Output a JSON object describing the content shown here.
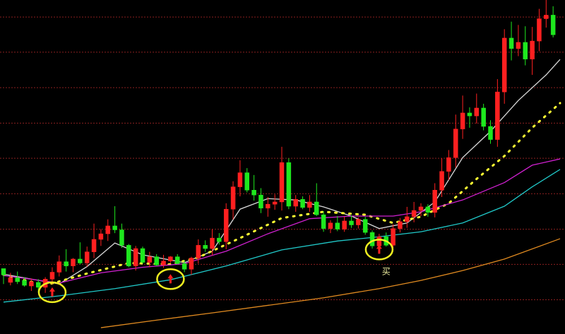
{
  "colors": {
    "background": "#000000",
    "grid": "#8a1f1f",
    "up_candle": "#ff2020",
    "down_candle": "#1ee81e",
    "ma_short": "#d8d8d8",
    "ma_dotted": "#ffff33",
    "ma_mid": "#d020d0",
    "ma_cyan": "#20c8c8",
    "ma_long": "#e08a20",
    "highlight_circle": "#f0f020",
    "signal_arrow": "#ff2020",
    "label": "#f0f0a0"
  },
  "annotations": {
    "buy_label": "买"
  },
  "chart_data": {
    "type": "candlestick",
    "title": "",
    "xlabel": "",
    "ylabel": "",
    "ylim": [
      0,
      100
    ],
    "grid": true,
    "gridlines_y": [
      8.7,
      19.5,
      30.2,
      41.0,
      51.8,
      62.5,
      73.3,
      84.1,
      94.8
    ],
    "candles": [
      {
        "o": 16.3,
        "h": 17.8,
        "l": 13.5,
        "c": 18.2,
        "dir": "down"
      },
      {
        "o": 14.0,
        "h": 16.9,
        "l": 13.1,
        "c": 15.4,
        "dir": "up"
      },
      {
        "o": 15.4,
        "h": 17.3,
        "l": 13.5,
        "c": 14.2,
        "dir": "down"
      },
      {
        "o": 14.6,
        "h": 15.6,
        "l": 12.7,
        "c": 13.1,
        "dir": "down"
      },
      {
        "o": 12.9,
        "h": 15.2,
        "l": 11.4,
        "c": 14.2,
        "dir": "up"
      },
      {
        "o": 14.0,
        "h": 15.0,
        "l": 11.0,
        "c": 12.5,
        "dir": "down"
      },
      {
        "o": 12.5,
        "h": 15.6,
        "l": 10.8,
        "c": 15.0,
        "dir": "up"
      },
      {
        "o": 15.0,
        "h": 18.6,
        "l": 13.5,
        "c": 17.1,
        "dir": "up"
      },
      {
        "o": 17.1,
        "h": 22.2,
        "l": 15.8,
        "c": 20.3,
        "dir": "up"
      },
      {
        "o": 20.3,
        "h": 24.1,
        "l": 17.3,
        "c": 19.0,
        "dir": "down"
      },
      {
        "o": 19.0,
        "h": 21.4,
        "l": 17.1,
        "c": 21.1,
        "dir": "up"
      },
      {
        "o": 21.1,
        "h": 26.2,
        "l": 19.5,
        "c": 19.9,
        "dir": "down"
      },
      {
        "o": 19.9,
        "h": 24.9,
        "l": 18.8,
        "c": 23.3,
        "dir": "up"
      },
      {
        "o": 23.3,
        "h": 31.9,
        "l": 21.4,
        "c": 27.1,
        "dir": "up"
      },
      {
        "o": 27.1,
        "h": 30.2,
        "l": 25.1,
        "c": 28.8,
        "dir": "up"
      },
      {
        "o": 28.8,
        "h": 33.2,
        "l": 26.6,
        "c": 31.2,
        "dir": "up"
      },
      {
        "o": 31.2,
        "h": 37.2,
        "l": 29.0,
        "c": 30.0,
        "dir": "down"
      },
      {
        "o": 30.0,
        "h": 31.9,
        "l": 24.5,
        "c": 25.3,
        "dir": "down"
      },
      {
        "o": 25.3,
        "h": 25.7,
        "l": 18.6,
        "c": 19.0,
        "dir": "down"
      },
      {
        "o": 19.0,
        "h": 25.1,
        "l": 17.6,
        "c": 24.3,
        "dir": "up"
      },
      {
        "o": 24.3,
        "h": 24.9,
        "l": 19.7,
        "c": 20.1,
        "dir": "down"
      },
      {
        "o": 20.1,
        "h": 23.3,
        "l": 18.6,
        "c": 21.8,
        "dir": "up"
      },
      {
        "o": 21.8,
        "h": 22.6,
        "l": 19.0,
        "c": 19.3,
        "dir": "down"
      },
      {
        "o": 19.3,
        "h": 22.4,
        "l": 18.4,
        "c": 20.5,
        "dir": "up"
      },
      {
        "o": 20.5,
        "h": 22.0,
        "l": 19.9,
        "c": 21.8,
        "dir": "up"
      },
      {
        "o": 21.8,
        "h": 22.6,
        "l": 19.5,
        "c": 19.7,
        "dir": "down"
      },
      {
        "o": 19.7,
        "h": 20.7,
        "l": 17.1,
        "c": 18.0,
        "dir": "down"
      },
      {
        "o": 18.0,
        "h": 21.8,
        "l": 16.3,
        "c": 21.4,
        "dir": "up"
      },
      {
        "o": 21.4,
        "h": 27.1,
        "l": 19.7,
        "c": 25.3,
        "dir": "up"
      },
      {
        "o": 25.3,
        "h": 26.8,
        "l": 23.3,
        "c": 24.3,
        "dir": "down"
      },
      {
        "o": 24.3,
        "h": 30.2,
        "l": 22.2,
        "c": 27.5,
        "dir": "up"
      },
      {
        "o": 27.5,
        "h": 29.0,
        "l": 25.5,
        "c": 26.4,
        "dir": "down"
      },
      {
        "o": 26.4,
        "h": 38.1,
        "l": 24.1,
        "c": 36.3,
        "dir": "up"
      },
      {
        "o": 36.3,
        "h": 44.8,
        "l": 33.2,
        "c": 43.1,
        "dir": "up"
      },
      {
        "o": 43.1,
        "h": 51.2,
        "l": 40.2,
        "c": 47.4,
        "dir": "up"
      },
      {
        "o": 47.4,
        "h": 48.8,
        "l": 41.4,
        "c": 42.1,
        "dir": "down"
      },
      {
        "o": 42.1,
        "h": 46.7,
        "l": 38.9,
        "c": 40.6,
        "dir": "down"
      },
      {
        "o": 40.6,
        "h": 42.7,
        "l": 35.1,
        "c": 36.6,
        "dir": "down"
      },
      {
        "o": 36.6,
        "h": 40.0,
        "l": 34.0,
        "c": 37.8,
        "dir": "up"
      },
      {
        "o": 37.8,
        "h": 40.8,
        "l": 36.1,
        "c": 38.5,
        "dir": "up"
      },
      {
        "o": 38.5,
        "h": 55.3,
        "l": 35.9,
        "c": 50.5,
        "dir": "up"
      },
      {
        "o": 50.5,
        "h": 51.8,
        "l": 36.3,
        "c": 37.2,
        "dir": "down"
      },
      {
        "o": 37.2,
        "h": 40.6,
        "l": 35.5,
        "c": 39.3,
        "dir": "up"
      },
      {
        "o": 39.3,
        "h": 40.2,
        "l": 36.3,
        "c": 36.8,
        "dir": "down"
      },
      {
        "o": 36.8,
        "h": 40.6,
        "l": 35.5,
        "c": 38.5,
        "dir": "up"
      },
      {
        "o": 38.5,
        "h": 44.2,
        "l": 34.2,
        "c": 34.6,
        "dir": "down"
      },
      {
        "o": 34.6,
        "h": 35.7,
        "l": 29.4,
        "c": 30.4,
        "dir": "down"
      },
      {
        "o": 30.4,
        "h": 32.9,
        "l": 29.0,
        "c": 32.1,
        "dir": "up"
      },
      {
        "o": 32.1,
        "h": 34.2,
        "l": 29.6,
        "c": 30.2,
        "dir": "down"
      },
      {
        "o": 30.2,
        "h": 34.0,
        "l": 29.4,
        "c": 32.7,
        "dir": "up"
      },
      {
        "o": 32.7,
        "h": 34.4,
        "l": 30.6,
        "c": 31.5,
        "dir": "down"
      },
      {
        "o": 31.5,
        "h": 33.8,
        "l": 30.4,
        "c": 33.2,
        "dir": "up"
      },
      {
        "o": 33.2,
        "h": 34.0,
        "l": 28.5,
        "c": 29.2,
        "dir": "down"
      },
      {
        "o": 29.2,
        "h": 29.8,
        "l": 24.3,
        "c": 25.1,
        "dir": "down"
      },
      {
        "o": 25.1,
        "h": 28.8,
        "l": 24.5,
        "c": 27.9,
        "dir": "up"
      },
      {
        "o": 27.9,
        "h": 29.2,
        "l": 24.9,
        "c": 25.3,
        "dir": "down"
      },
      {
        "o": 25.3,
        "h": 31.7,
        "l": 24.5,
        "c": 30.4,
        "dir": "up"
      },
      {
        "o": 30.4,
        "h": 33.6,
        "l": 29.2,
        "c": 32.5,
        "dir": "up"
      },
      {
        "o": 32.5,
        "h": 37.0,
        "l": 30.6,
        "c": 34.0,
        "dir": "up"
      },
      {
        "o": 34.0,
        "h": 38.5,
        "l": 32.3,
        "c": 35.9,
        "dir": "up"
      },
      {
        "o": 35.9,
        "h": 38.1,
        "l": 34.2,
        "c": 37.0,
        "dir": "up"
      },
      {
        "o": 37.0,
        "h": 37.8,
        "l": 34.0,
        "c": 35.3,
        "dir": "down"
      },
      {
        "o": 35.3,
        "h": 44.2,
        "l": 33.8,
        "c": 42.1,
        "dir": "up"
      },
      {
        "o": 42.1,
        "h": 51.8,
        "l": 40.0,
        "c": 47.8,
        "dir": "up"
      },
      {
        "o": 47.8,
        "h": 54.3,
        "l": 45.2,
        "c": 52.0,
        "dir": "up"
      },
      {
        "o": 52.0,
        "h": 65.1,
        "l": 49.0,
        "c": 60.7,
        "dir": "up"
      },
      {
        "o": 60.7,
        "h": 70.9,
        "l": 57.7,
        "c": 65.6,
        "dir": "up"
      },
      {
        "o": 65.6,
        "h": 67.3,
        "l": 61.1,
        "c": 64.7,
        "dir": "down"
      },
      {
        "o": 64.7,
        "h": 71.5,
        "l": 62.4,
        "c": 67.1,
        "dir": "up"
      },
      {
        "o": 67.1,
        "h": 68.4,
        "l": 60.3,
        "c": 61.5,
        "dir": "down"
      },
      {
        "o": 61.5,
        "h": 63.4,
        "l": 56.2,
        "c": 57.5,
        "dir": "down"
      },
      {
        "o": 57.5,
        "h": 75.9,
        "l": 55.3,
        "c": 72.0,
        "dir": "up"
      },
      {
        "o": 72.0,
        "h": 91.1,
        "l": 68.4,
        "c": 88.4,
        "dir": "up"
      },
      {
        "o": 88.4,
        "h": 93.4,
        "l": 81.6,
        "c": 85.2,
        "dir": "down"
      },
      {
        "o": 85.2,
        "h": 92.4,
        "l": 82.9,
        "c": 87.1,
        "dir": "up"
      },
      {
        "o": 87.1,
        "h": 92.0,
        "l": 80.1,
        "c": 82.0,
        "dir": "down"
      },
      {
        "o": 82.0,
        "h": 91.8,
        "l": 77.2,
        "c": 87.5,
        "dir": "up"
      },
      {
        "o": 87.5,
        "h": 97.3,
        "l": 84.4,
        "c": 94.3,
        "dir": "up"
      },
      {
        "o": 94.3,
        "h": 100.0,
        "l": 91.6,
        "c": 95.4,
        "dir": "up"
      },
      {
        "o": 95.4,
        "h": 98.1,
        "l": 88.6,
        "c": 89.4,
        "dir": "down"
      }
    ],
    "lines": [
      {
        "name": "",
        "style": "solid",
        "color_key": "ma_short",
        "points": [
          [
            0,
            16.5
          ],
          [
            8,
            13.5
          ],
          [
            12,
            18.8
          ],
          [
            16,
            26.0
          ],
          [
            20,
            22.4
          ],
          [
            26,
            20.0
          ],
          [
            30,
            23.5
          ],
          [
            34,
            36.3
          ],
          [
            38,
            39.5
          ],
          [
            42,
            39.1
          ],
          [
            46,
            37.0
          ],
          [
            50,
            34.2
          ],
          [
            54,
            30.4
          ],
          [
            58,
            32.1
          ],
          [
            62,
            38.5
          ],
          [
            66,
            52.0
          ],
          [
            70,
            60.0
          ],
          [
            74,
            69.4
          ],
          [
            78,
            77.2
          ],
          [
            80,
            81.9
          ]
        ]
      },
      {
        "name": "",
        "style": "dotted",
        "color_key": "ma_dotted",
        "points": [
          [
            0,
            16.3
          ],
          [
            6,
            13.1
          ],
          [
            12,
            16.7
          ],
          [
            18,
            19.9
          ],
          [
            24,
            19.5
          ],
          [
            28,
            21.6
          ],
          [
            34,
            27.5
          ],
          [
            40,
            33.6
          ],
          [
            46,
            35.5
          ],
          [
            52,
            34.6
          ],
          [
            56,
            32.1
          ],
          [
            60,
            34.0
          ],
          [
            64,
            38.1
          ],
          [
            68,
            45.5
          ],
          [
            72,
            52.5
          ],
          [
            76,
            61.1
          ],
          [
            80,
            68.6
          ]
        ]
      },
      {
        "name": "",
        "style": "solid",
        "color_key": "ma_mid",
        "points": [
          [
            0,
            16.1
          ],
          [
            8,
            13.8
          ],
          [
            14,
            16.9
          ],
          [
            20,
            18.6
          ],
          [
            26,
            19.7
          ],
          [
            32,
            23.5
          ],
          [
            38,
            28.8
          ],
          [
            44,
            33.4
          ],
          [
            50,
            34.2
          ],
          [
            56,
            34.2
          ],
          [
            60,
            35.5
          ],
          [
            66,
            39.1
          ],
          [
            72,
            44.4
          ],
          [
            76,
            49.7
          ],
          [
            80,
            51.6
          ]
        ]
      },
      {
        "name": "",
        "style": "solid",
        "color_key": "ma_cyan",
        "points": [
          [
            0,
            8.0
          ],
          [
            8,
            9.9
          ],
          [
            16,
            12.1
          ],
          [
            24,
            14.8
          ],
          [
            32,
            19.0
          ],
          [
            40,
            23.9
          ],
          [
            48,
            26.6
          ],
          [
            54,
            27.9
          ],
          [
            60,
            29.4
          ],
          [
            66,
            32.1
          ],
          [
            72,
            37.2
          ],
          [
            76,
            43.1
          ],
          [
            80,
            48.4
          ]
        ]
      },
      {
        "name": "",
        "style": "solid",
        "color_key": "ma_long",
        "points": [
          [
            14,
            0.2
          ],
          [
            22,
            2.5
          ],
          [
            30,
            4.7
          ],
          [
            38,
            7.0
          ],
          [
            46,
            9.3
          ],
          [
            54,
            12.1
          ],
          [
            60,
            14.6
          ],
          [
            66,
            17.6
          ],
          [
            72,
            21.1
          ],
          [
            80,
            27.3
          ]
        ]
      }
    ],
    "signals": [
      {
        "candle_index": 7,
        "value": 11.0,
        "type": "buy-arrow",
        "circled": true
      },
      {
        "candle_index": 24,
        "value": 15.0,
        "type": "buy-arrow",
        "circled": true
      },
      {
        "candle_index": 54,
        "value": 24.0,
        "type": "buy-arrow",
        "circled": true
      }
    ],
    "labels": [
      {
        "candle_index": 55,
        "value": 16.5,
        "text_key": "buy_label"
      }
    ]
  }
}
